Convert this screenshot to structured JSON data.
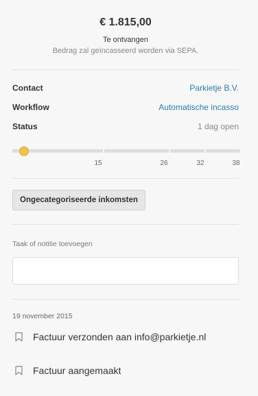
{
  "summary": {
    "amount": "€ 1.815,00",
    "status_line": "Te ontvangen",
    "note": "Bedrag zal geïncasseerd worden via SEPA."
  },
  "details": [
    {
      "label": "Contact",
      "value": "Parkietje B.V.",
      "link": true
    },
    {
      "label": "Workflow",
      "value": "Automatische incasso",
      "link": true
    },
    {
      "label": "Status",
      "value": "1 dag open",
      "link": false
    }
  ],
  "timeline": {
    "current": 1,
    "ticks": [
      "15",
      "26",
      "32",
      "38"
    ]
  },
  "category_button": "Ongecategoriseerde inkomsten",
  "task": {
    "label": "Taak of notitie toevoegen",
    "value": "",
    "placeholder": ""
  },
  "history": {
    "date": "19 november 2015",
    "items": [
      {
        "text": "Factuur verzonden aan info@parkietje.nl",
        "icon": "bookmark-icon"
      },
      {
        "text": "Factuur aangemaakt",
        "icon": "bookmark-icon"
      }
    ]
  },
  "colors": {
    "link": "#2a7ab0",
    "slider_thumb": "#f0c34b",
    "background": "#f7f7f7"
  }
}
